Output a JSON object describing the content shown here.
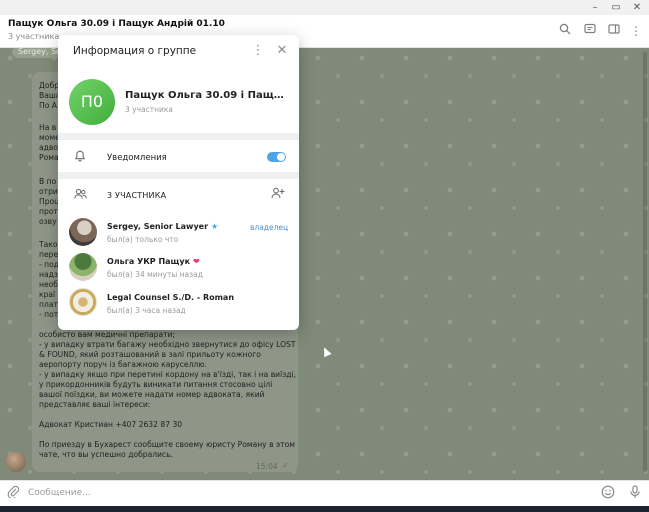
{
  "window": {
    "minimize_icon": "minimize-icon",
    "maximize_icon": "maximize-icon",
    "close_icon": "close-icon"
  },
  "chat": {
    "title": "Пащук Ольга 30.09 і Пащук Андрій 01.10",
    "subtitle": "3 участника",
    "sender_chip": "Sergey, Se",
    "header_icons": [
      "search-icon",
      "channel-icon",
      "sidebar-icon",
      "more-icon"
    ],
    "left_fragments": [
      "Добр",
      "Ваша",
      "По А",
      "На в",
      "моме",
      "адво",
      "Рома",
      "В по",
      "отри",
      "Проц",
      "прот",
      "озву",
      "Такоі",
      "пере",
      "- под",
      "надз",
      "необ",
      "краї",
      "плат",
      "- пот"
    ],
    "message_lines": [
      "особисто вам медичні препарати;",
      "- у випадку втрати багажу необхідно звернутися до офісу LOST & FOUND, який розташований в залі прильоту кожного аеропорту поруч із багажною каруселлю.",
      "- у випадку якщо при перетині кордону на в'їзді, так і на виїзді, у прикордонників будуть виникати питання стосовно цілі вашої поїздки, ви можете надати номер адвоката, який представляє ваші інтереси:",
      "",
      "Адвокат Кристиан +407 2632 87 30",
      "",
      "По приезду в Бухарест сообщите своему юристу Роману в этом чате, что вы успешно добрались."
    ],
    "message_time": "15:04"
  },
  "composer": {
    "placeholder": "Сообщение..."
  },
  "dialog": {
    "title": "Информация о группе",
    "group_avatar_initials": "П0",
    "group_name": "Пащук Ольга 30.09 і Пащук Андрій 01.10",
    "group_count": "3 участника",
    "notifications_label": "Уведомления",
    "notifications_enabled": true,
    "members_header": "3 УЧАСТНИКА",
    "members": [
      {
        "name": "Sergey, Senior Lawyer",
        "status": "был(а) только что",
        "badge": "владелец",
        "icon": "verified-star-icon"
      },
      {
        "name": "Ольга УКР Пащук",
        "status": "был(а) 34 минуты назад",
        "badge": "",
        "icon": "heart-emoji-icon"
      },
      {
        "name": "Legal Counsel S./D. - Roman",
        "status": "был(а) 3 часа назад",
        "badge": "",
        "icon": ""
      }
    ]
  },
  "colors": {
    "accent": "#4ea4e5",
    "group_avatar": "#5cc152",
    "owner_badge": "#4a90c8"
  }
}
